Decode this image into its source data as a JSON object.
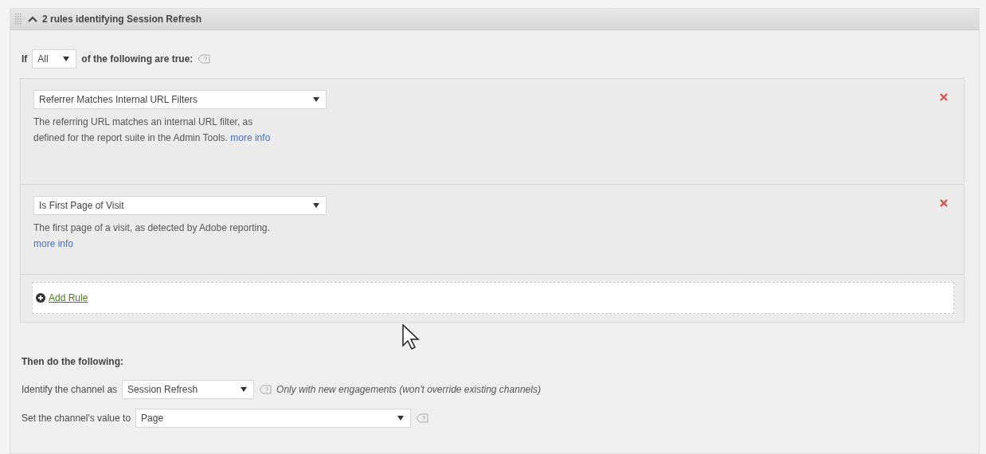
{
  "section": {
    "title": "2 rules identifying Session Refresh",
    "expanded": true
  },
  "condition": {
    "prefix": "If",
    "match": "All",
    "suffix": "of the following are true:"
  },
  "rules": [
    {
      "type": "Referrer Matches Internal URL Filters",
      "description": "The referring URL matches an internal URL filter, as defined for the report suite in the Admin Tools.",
      "link": "more info"
    },
    {
      "type": "Is First Page of Visit",
      "description": "The first page of a visit, as detected by Adobe reporting.",
      "link": "more info"
    }
  ],
  "add_rule": "Add Rule",
  "actions": {
    "heading": "Then do the following:",
    "rows": [
      {
        "label": "Identify the channel as",
        "value": "Session Refresh",
        "note": "Only with new engagements (won't override existing channels)"
      },
      {
        "label": "Set the channel's value to",
        "value": "Page"
      }
    ]
  }
}
